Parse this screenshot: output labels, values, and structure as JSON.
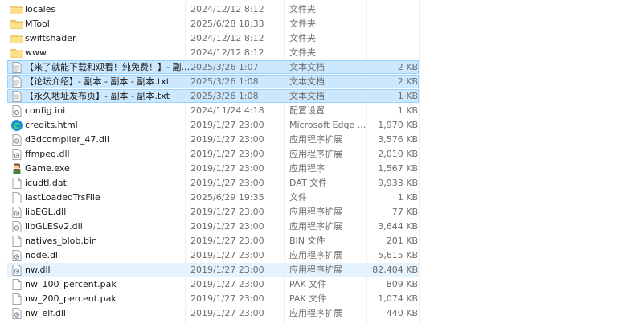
{
  "files": [
    {
      "name": "locales",
      "date": "2024/12/12 8:12",
      "type": "文件夹",
      "size": "",
      "icon": "folder-icon",
      "state": ""
    },
    {
      "name": "MTool",
      "date": "2025/6/28 18:33",
      "type": "文件夹",
      "size": "",
      "icon": "folder-icon",
      "state": ""
    },
    {
      "name": "swiftshader",
      "date": "2024/12/12 8:12",
      "type": "文件夹",
      "size": "",
      "icon": "folder-icon",
      "state": ""
    },
    {
      "name": "www",
      "date": "2024/12/12 8:12",
      "type": "文件夹",
      "size": "",
      "icon": "folder-icon",
      "state": ""
    },
    {
      "name": "【来了就能下载和观看！纯免费！】- 副...",
      "date": "2025/3/26 1:07",
      "type": "文本文档",
      "size": "2 KB",
      "icon": "text-file-icon",
      "state": "selected"
    },
    {
      "name": "【论坛介绍】- 副本 - 副本 - 副本.txt",
      "date": "2025/3/26 1:08",
      "type": "文本文档",
      "size": "2 KB",
      "icon": "text-file-icon",
      "state": "selected"
    },
    {
      "name": "【永久地址发布页】- 副本 - 副本.txt",
      "date": "2025/3/26 1:08",
      "type": "文本文档",
      "size": "1 KB",
      "icon": "text-file-icon",
      "state": "selected"
    },
    {
      "name": "config.ini",
      "date": "2024/11/24 4:18",
      "type": "配置设置",
      "size": "1 KB",
      "icon": "config-file-icon",
      "state": ""
    },
    {
      "name": "credits.html",
      "date": "2019/1/27 23:00",
      "type": "Microsoft Edge ...",
      "size": "1,970 KB",
      "icon": "edge-icon",
      "state": ""
    },
    {
      "name": "d3dcompiler_47.dll",
      "date": "2019/1/27 23:00",
      "type": "应用程序扩展",
      "size": "3,576 KB",
      "icon": "dll-file-icon",
      "state": ""
    },
    {
      "name": "ffmpeg.dll",
      "date": "2019/1/27 23:00",
      "type": "应用程序扩展",
      "size": "2,010 KB",
      "icon": "dll-file-icon",
      "state": ""
    },
    {
      "name": "Game.exe",
      "date": "2019/1/27 23:00",
      "type": "应用程序",
      "size": "1,567 KB",
      "icon": "game-exe-icon",
      "state": ""
    },
    {
      "name": "icudtl.dat",
      "date": "2019/1/27 23:00",
      "type": "DAT 文件",
      "size": "9,933 KB",
      "icon": "blank-file-icon",
      "state": ""
    },
    {
      "name": "lastLoadedTrsFile",
      "date": "2025/6/29 19:35",
      "type": "文件",
      "size": "1 KB",
      "icon": "blank-file-icon",
      "state": ""
    },
    {
      "name": "libEGL.dll",
      "date": "2019/1/27 23:00",
      "type": "应用程序扩展",
      "size": "77 KB",
      "icon": "dll-file-icon",
      "state": ""
    },
    {
      "name": "libGLESv2.dll",
      "date": "2019/1/27 23:00",
      "type": "应用程序扩展",
      "size": "3,644 KB",
      "icon": "dll-file-icon",
      "state": ""
    },
    {
      "name": "natives_blob.bin",
      "date": "2019/1/27 23:00",
      "type": "BIN 文件",
      "size": "201 KB",
      "icon": "blank-file-icon",
      "state": ""
    },
    {
      "name": "node.dll",
      "date": "2019/1/27 23:00",
      "type": "应用程序扩展",
      "size": "5,615 KB",
      "icon": "dll-file-icon",
      "state": ""
    },
    {
      "name": "nw.dll",
      "date": "2019/1/27 23:00",
      "type": "应用程序扩展",
      "size": "82,404 KB",
      "icon": "dll-file-icon",
      "state": "hover"
    },
    {
      "name": "nw_100_percent.pak",
      "date": "2019/1/27 23:00",
      "type": "PAK 文件",
      "size": "809 KB",
      "icon": "blank-file-icon",
      "state": ""
    },
    {
      "name": "nw_200_percent.pak",
      "date": "2019/1/27 23:00",
      "type": "PAK 文件",
      "size": "1,074 KB",
      "icon": "blank-file-icon",
      "state": ""
    },
    {
      "name": "nw_elf.dll",
      "date": "2019/1/27 23:00",
      "type": "应用程序扩展",
      "size": "440 KB",
      "icon": "dll-file-icon",
      "state": ""
    }
  ]
}
